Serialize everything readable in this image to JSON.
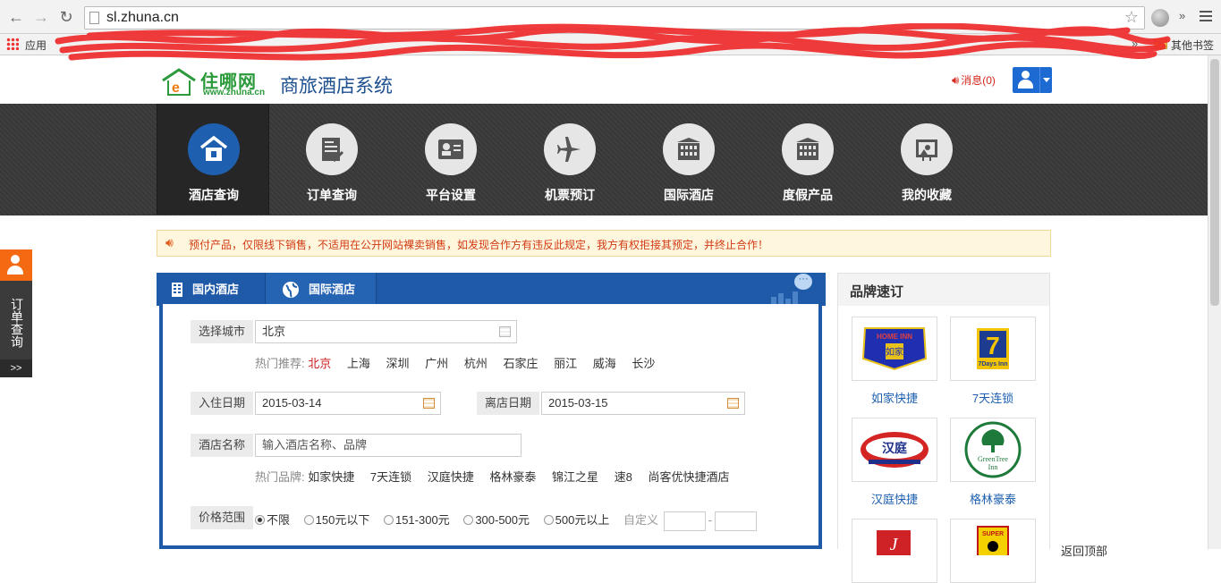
{
  "browser": {
    "url": "sl.zhuna.cn",
    "bookmarks": {
      "apps_label": "应用",
      "other_label": "其他书签"
    }
  },
  "header": {
    "logo_text": "住哪网",
    "logo_url": "www.zhuna.cn",
    "site_title": "商旅酒店系统",
    "message_label": "消息(0)"
  },
  "nav": {
    "items": [
      {
        "label": "酒店查询",
        "icon": "house-icon"
      },
      {
        "label": "订单查询",
        "icon": "document-icon"
      },
      {
        "label": "平台设置",
        "icon": "id-card-icon"
      },
      {
        "label": "机票预订",
        "icon": "airplane-icon"
      },
      {
        "label": "国际酒店",
        "icon": "building-icon"
      },
      {
        "label": "度假产品",
        "icon": "building-icon"
      },
      {
        "label": "我的收藏",
        "icon": "favorite-image-icon"
      }
    ]
  },
  "notice": {
    "text": "预付产品，仅限线下销售，不适用在公开网站裸卖销售，如发现合作方有违反此规定，我方有权拒接其预定，并终止合作！"
  },
  "side_widget": {
    "label": "订单查询",
    "more": ">>"
  },
  "search": {
    "tabs": [
      {
        "label": "国内酒店"
      },
      {
        "label": "国际酒店"
      }
    ],
    "city": {
      "label": "选择城市",
      "value": "北京",
      "hot_label": "热门推荐:",
      "hot_cities": [
        "北京",
        "上海",
        "深圳",
        "广州",
        "杭州",
        "石家庄",
        "丽江",
        "威海",
        "长沙"
      ]
    },
    "checkin": {
      "label": "入住日期",
      "value": "2015-03-14"
    },
    "checkout": {
      "label": "离店日期",
      "value": "2015-03-15"
    },
    "hotel_name": {
      "label": "酒店名称",
      "placeholder": "输入酒店名称、品牌",
      "hot_label": "热门品牌:",
      "hot_brands": [
        "如家快捷",
        "7天连锁",
        "汉庭快捷",
        "格林豪泰",
        "锦江之星",
        "速8",
        "尚客优快捷酒店"
      ]
    },
    "price": {
      "label": "价格范围",
      "options": [
        "不限",
        "150元以下",
        "151-300元",
        "300-500元",
        "500元以上"
      ],
      "selected": "不限",
      "custom_label": "自定义",
      "dash": "-"
    }
  },
  "brands": {
    "title": "品牌速订",
    "items": [
      {
        "name": "如家快捷",
        "logo_text": "HOME INN 如家"
      },
      {
        "name": "7天连锁",
        "logo_text": "7 Days Inn"
      },
      {
        "name": "汉庭快捷",
        "logo_text": "汉庭"
      },
      {
        "name": "格林豪泰",
        "logo_text": "GreenTree Inn"
      }
    ]
  },
  "back_top": "返回顶部"
}
